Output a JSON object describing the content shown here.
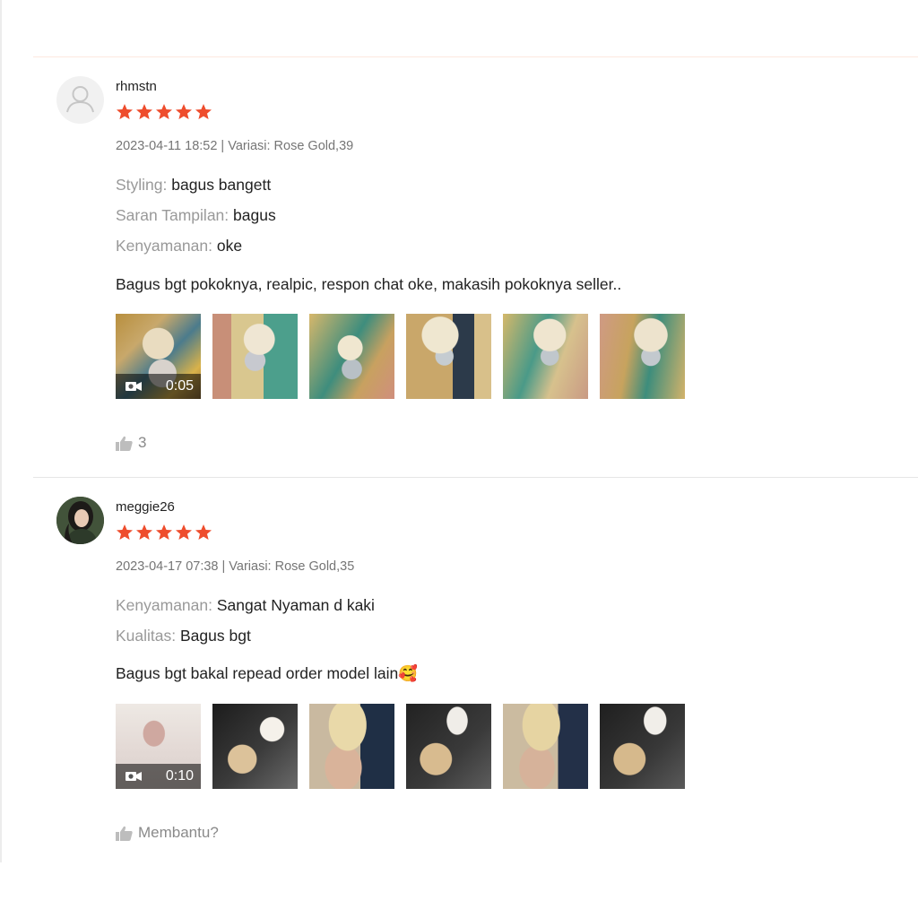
{
  "colors": {
    "star": "#ee4d2d",
    "muted": "#757575",
    "attr_key": "#999999"
  },
  "reviews": [
    {
      "username": "rhmstn",
      "rating": 5,
      "meta": "2023-04-11 18:52 | Variasi: Rose Gold,39",
      "attributes": [
        {
          "key": "Styling:",
          "value": "bagus bangett"
        },
        {
          "key": "Saran Tampilan:",
          "value": "bagus"
        },
        {
          "key": "Kenyamanan:",
          "value": "oke"
        }
      ],
      "comment": "Bagus bgt pokoknya, realpic, respon chat oke, makasih pokoknya seller..",
      "video_duration": "0:05",
      "like_label": "3"
    },
    {
      "username": "meggie26",
      "rating": 5,
      "meta": "2023-04-17 07:38 | Variasi: Rose Gold,35",
      "attributes": [
        {
          "key": "Kenyamanan:",
          "value": "Sangat Nyaman d kaki"
        },
        {
          "key": "Kualitas:",
          "value": "Bagus bgt"
        }
      ],
      "comment": "Bagus bgt bakal repead order model lain🥰",
      "video_duration": "0:10",
      "like_label": "Membantu?"
    }
  ]
}
